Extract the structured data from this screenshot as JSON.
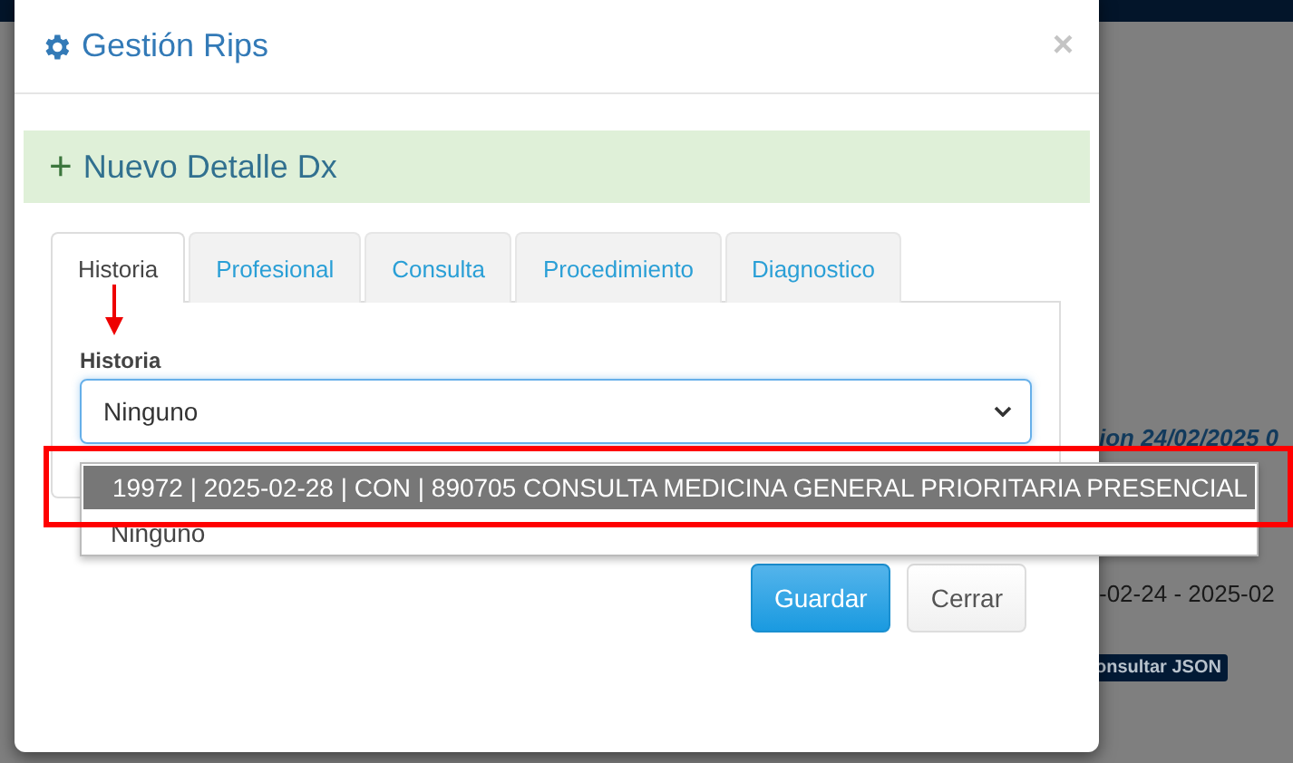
{
  "background": {
    "heading_fragment": "ion 24/02/2025 0",
    "dates_fragment": "-02-24 - 2025-02",
    "badge": "onsultar JSON"
  },
  "modal": {
    "title": "Gestión Rips",
    "close": "×",
    "alert": {
      "icon": "+",
      "text": "Nuevo Detalle Dx"
    },
    "tabs": [
      {
        "label": "Historia",
        "selected": true
      },
      {
        "label": "Profesional",
        "selected": false
      },
      {
        "label": "Consulta",
        "selected": false
      },
      {
        "label": "Procedimiento",
        "selected": false
      },
      {
        "label": "Diagnostico",
        "selected": false
      }
    ],
    "field": {
      "label": "Historia",
      "value": "Ninguno",
      "options": [
        {
          "label": "19972 | 2025-02-28 | CON | 890705 CONSULTA MEDICINA GENERAL PRIORITARIA PRESENCIAL",
          "highlighted": true
        },
        {
          "label": "Ninguno",
          "highlighted": false
        }
      ]
    },
    "buttons": [
      {
        "label": "Guardar",
        "kind": "primary"
      },
      {
        "label": "Cerrar",
        "kind": "default"
      }
    ]
  }
}
